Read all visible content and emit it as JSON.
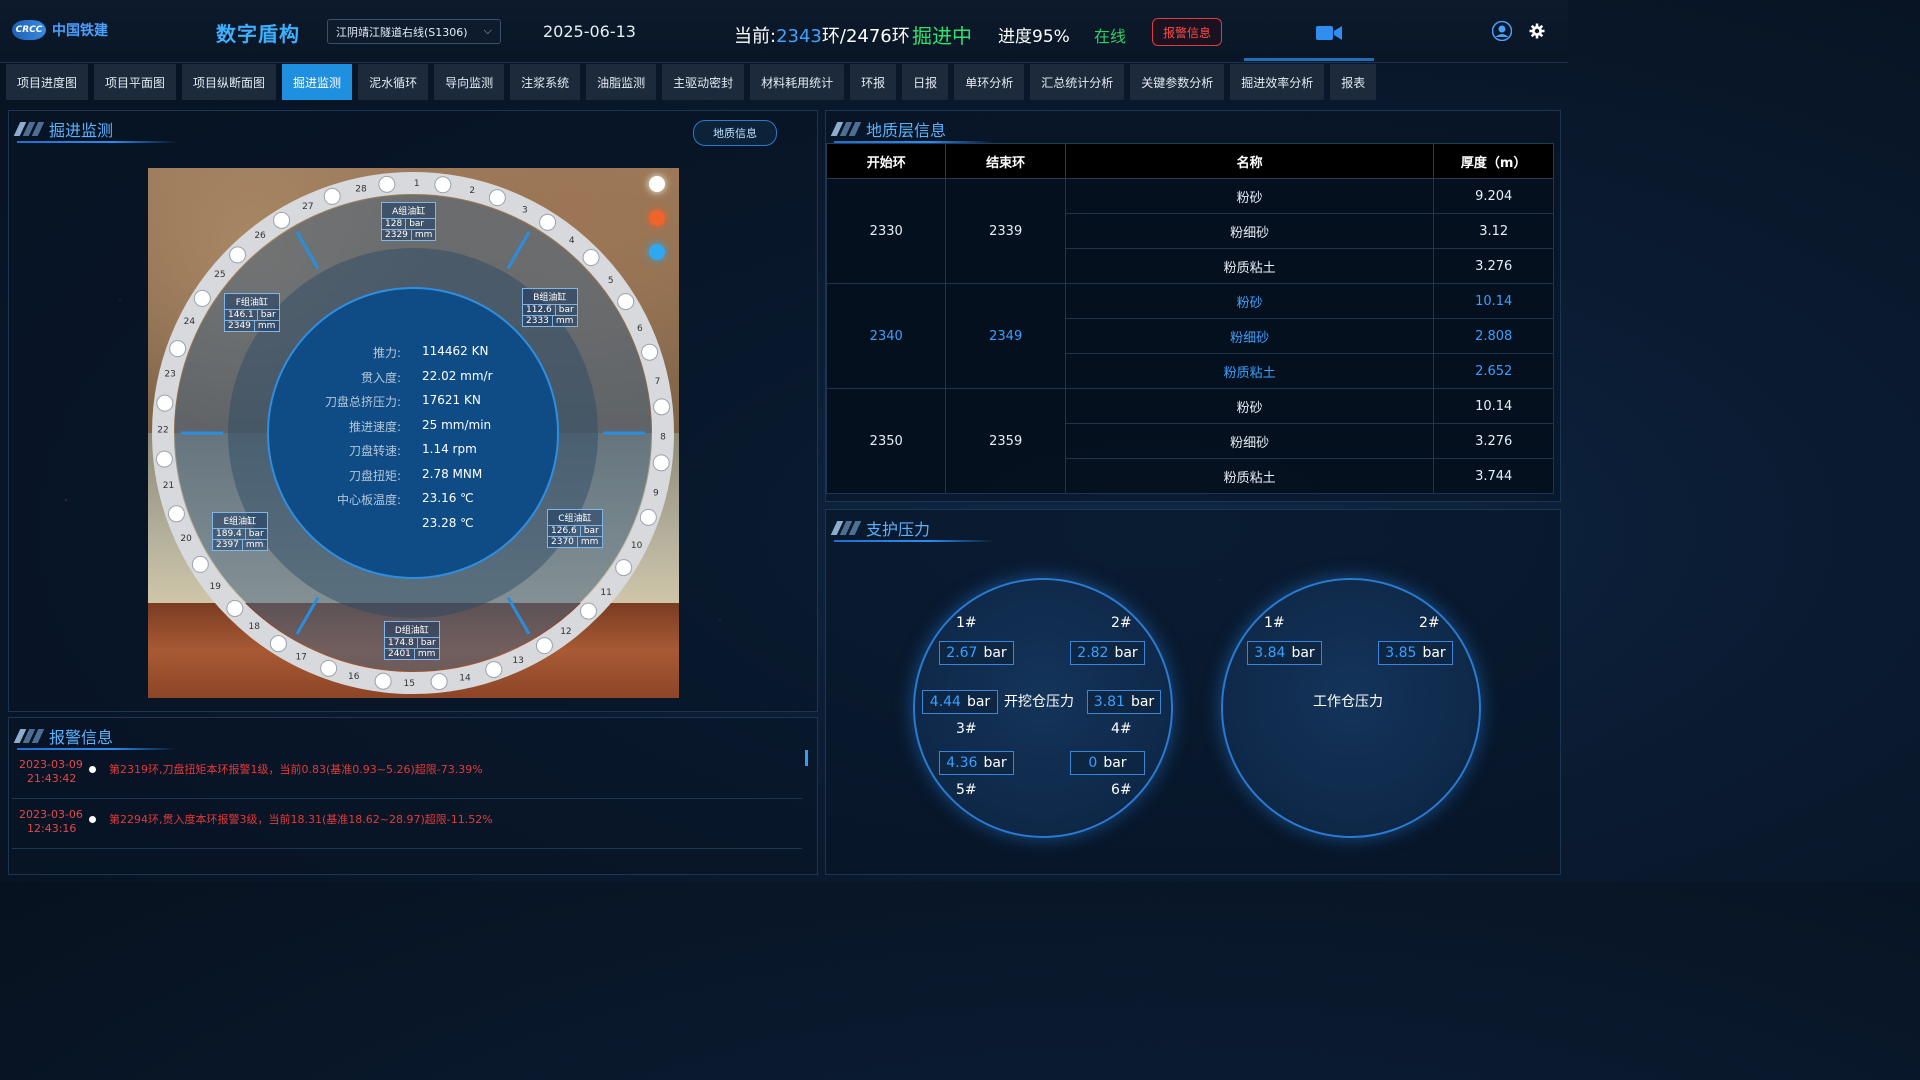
{
  "header": {
    "logo_badge": "CRCC",
    "logo_text": "中国铁建",
    "app_title": "数字盾构",
    "project": "江阴靖江隧道右线(S1306)",
    "date": "2025-06-13",
    "ring_prefix": "当前:",
    "ring_current": "2343",
    "ring_suffix": "环/2476环",
    "state": "掘进中",
    "progress": "进度95%",
    "online": "在线",
    "alarm_button": "报警信息"
  },
  "tabs": [
    "项目进度图",
    "项目平面图",
    "项目纵断面图",
    "掘进监测",
    "泥水循环",
    "导向监测",
    "注浆系统",
    "油脂监测",
    "主驱动密封",
    "材料耗用统计",
    "环报",
    "日报",
    "单环分析",
    "汇总统计分析",
    "关键参数分析",
    "掘进效率分析",
    "报表"
  ],
  "active_tab": "掘进监测",
  "monitor": {
    "title": "掘进监测",
    "geo_button": "地质信息",
    "cylinders": [
      {
        "name": "A组油缸",
        "pressure": "128",
        "stroke": "2329"
      },
      {
        "name": "B组油缸",
        "pressure": "112.6",
        "stroke": "2333"
      },
      {
        "name": "C组油缸",
        "pressure": "126.6",
        "stroke": "2370"
      },
      {
        "name": "D组油缸",
        "pressure": "174.8",
        "stroke": "2401"
      },
      {
        "name": "E组油缸",
        "pressure": "189.4",
        "stroke": "2397"
      },
      {
        "name": "F组油缸",
        "pressure": "146.1",
        "stroke": "2349"
      }
    ],
    "unit_bar": "bar",
    "unit_mm": "mm",
    "params": [
      {
        "label": "推力:",
        "value": "114462 KN"
      },
      {
        "label": "贯入度:",
        "value": "22.02 mm/r"
      },
      {
        "label": "刀盘总挤压力:",
        "value": "17621 KN"
      },
      {
        "label": "推进速度:",
        "value": "25 mm/min"
      },
      {
        "label": "刀盘转速:",
        "value": "1.14 rpm"
      },
      {
        "label": "刀盘扭矩:",
        "value": "2.78 MNM"
      },
      {
        "label": "中心板温度:",
        "value": "23.16 ℃"
      },
      {
        "label": "",
        "value": "23.28 ℃"
      }
    ],
    "ring_numbers": [
      "1",
      "2",
      "3",
      "4",
      "5",
      "6",
      "7",
      "8",
      "9",
      "10",
      "11",
      "12",
      "13",
      "14",
      "15",
      "16",
      "17",
      "18",
      "19",
      "20",
      "21",
      "22",
      "23",
      "24",
      "25",
      "26",
      "27",
      "28"
    ],
    "legend_colors": [
      "#ffffff",
      "#f0632a",
      "#2fa8f0"
    ]
  },
  "alarm": {
    "title": "报警信息",
    "items": [
      {
        "date": "2023-03-09",
        "time": "21:43:42",
        "message": "第2319环,刀盘扭矩本环报警1级，当前0.83(基准0.93~5.26)超限-73.39%"
      },
      {
        "date": "2023-03-06",
        "time": "12:43:16",
        "message": "第2294环,贯入度本环报警3级，当前18.31(基准18.62~28.97)超限-11.52%"
      }
    ]
  },
  "geology": {
    "title": "地质层信息",
    "headers": [
      "开始环",
      "结束环",
      "名称",
      "厚度（m）"
    ],
    "groups": [
      {
        "start": "2330",
        "end": "2339",
        "highlight": false,
        "layers": [
          {
            "name": "粉砂",
            "thickness": "9.204"
          },
          {
            "name": "粉细砂",
            "thickness": "3.12"
          },
          {
            "name": "粉质粘土",
            "thickness": "3.276"
          }
        ]
      },
      {
        "start": "2340",
        "end": "2349",
        "highlight": true,
        "layers": [
          {
            "name": "粉砂",
            "thickness": "10.14"
          },
          {
            "name": "粉细砂",
            "thickness": "2.808"
          },
          {
            "name": "粉质粘土",
            "thickness": "2.652"
          }
        ]
      },
      {
        "start": "2350",
        "end": "2359",
        "highlight": false,
        "layers": [
          {
            "name": "粉砂",
            "thickness": "10.14"
          },
          {
            "name": "粉细砂",
            "thickness": "3.276"
          },
          {
            "name": "粉质粘土",
            "thickness": "3.744"
          }
        ]
      }
    ]
  },
  "support": {
    "title": "支护压力",
    "excavation": {
      "center_label": "开挖仓压力",
      "labels": [
        "1#",
        "2#",
        "3#",
        "4#",
        "5#",
        "6#"
      ],
      "values": [
        "2.67",
        "2.82",
        "4.44",
        "3.81",
        "4.36",
        "0"
      ]
    },
    "working": {
      "center_label": "工作仓压力",
      "labels": [
        "1#",
        "2#"
      ],
      "values": [
        "3.84",
        "3.85"
      ]
    },
    "unit": "bar"
  }
}
